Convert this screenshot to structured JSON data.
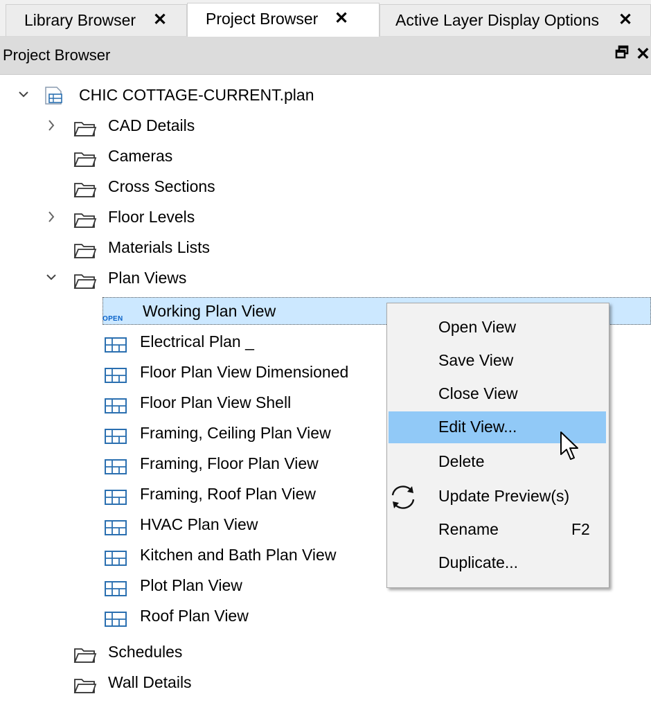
{
  "tabs": [
    {
      "label": "Library Browser",
      "active": false
    },
    {
      "label": "Project Browser",
      "active": true
    },
    {
      "label": "Active Layer Display Options",
      "active": false
    }
  ],
  "tab_close_glyph": "✕",
  "panel": {
    "title": "Project Browser",
    "float_glyph": "🗗",
    "close_glyph": "✕"
  },
  "tree": {
    "root": {
      "label": "CHIC COTTAGE-CURRENT.plan",
      "icon": "plan-file-icon",
      "expanded": true
    },
    "folders": [
      {
        "label": "CAD Details",
        "expandable": true
      },
      {
        "label": "Cameras",
        "expandable": false
      },
      {
        "label": "Cross Sections",
        "expandable": false
      },
      {
        "label": "Floor Levels",
        "expandable": true
      },
      {
        "label": "Materials Lists",
        "expandable": false
      },
      {
        "label": "Plan Views",
        "expandable": true,
        "expanded": true
      }
    ],
    "plan_views": [
      {
        "label": "Working Plan View",
        "badge": "OPEN",
        "selected": true
      },
      {
        "label": "Electrical Plan _"
      },
      {
        "label": "Floor Plan View Dimensioned"
      },
      {
        "label": "Floor Plan View Shell"
      },
      {
        "label": "Framing, Ceiling Plan View"
      },
      {
        "label": "Framing, Floor Plan View"
      },
      {
        "label": "Framing, Roof Plan View"
      },
      {
        "label": "HVAC Plan View"
      },
      {
        "label": "Kitchen and Bath Plan View"
      },
      {
        "label": "Plot Plan View"
      },
      {
        "label": "Roof Plan View"
      }
    ],
    "folders_after": [
      {
        "label": "Schedules"
      },
      {
        "label": "Wall Details"
      }
    ]
  },
  "context_menu": {
    "items": [
      {
        "label": "Open View",
        "shortcut": ""
      },
      {
        "label": "Save View",
        "shortcut": ""
      },
      {
        "label": "Close View",
        "shortcut": ""
      },
      {
        "label": "Edit View...",
        "shortcut": "",
        "hover": true
      },
      {
        "label": "Delete",
        "shortcut": ""
      },
      {
        "label": "Update Preview(s)",
        "shortcut": "",
        "icon": "refresh-icon"
      },
      {
        "label": "Rename",
        "shortcut": "F2"
      },
      {
        "label": "Duplicate...",
        "shortcut": ""
      }
    ]
  },
  "colors": {
    "selection": "#cce8ff",
    "menu_hover": "#91c9f7",
    "open_badge": "#0b63c9",
    "icon_blue": "#2a6fb0"
  }
}
